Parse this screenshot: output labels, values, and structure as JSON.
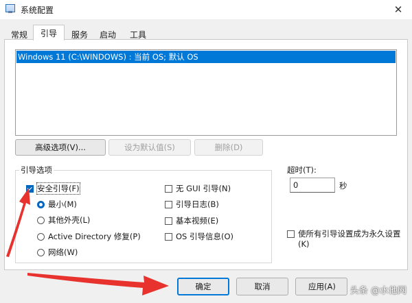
{
  "window": {
    "title": "系统配置",
    "close_glyph": "✕"
  },
  "tabs": [
    {
      "label": "常规"
    },
    {
      "label": "引导"
    },
    {
      "label": "服务"
    },
    {
      "label": "启动"
    },
    {
      "label": "工具"
    }
  ],
  "active_tab": "引导",
  "boot_list": {
    "items": [
      "Windows 11 (C:\\WINDOWS) : 当前 OS; 默认 OS"
    ]
  },
  "boot_buttons": {
    "advanced": "高级选项(V)...",
    "set_default": "设为默认值(S)",
    "delete": "删除(D)"
  },
  "boot_options": {
    "group_label": "引导选项",
    "safe_boot": {
      "label": "安全引导(F)",
      "checked": true
    },
    "minimal": {
      "label": "最小(M)",
      "selected": true
    },
    "alternate_shell": {
      "label": "其他外壳(L)",
      "selected": false
    },
    "active_directory": {
      "label": "Active Directory 修复(P)",
      "selected": false
    },
    "network": {
      "label": "网络(W)",
      "selected": false
    },
    "no_gui": {
      "label": "无 GUI 引导(N)",
      "checked": false
    },
    "boot_log": {
      "label": "引导日志(B)",
      "checked": false
    },
    "base_video": {
      "label": "基本视频(E)",
      "checked": false
    },
    "os_boot_info": {
      "label": "OS 引导信息(O)",
      "checked": false
    }
  },
  "timeout": {
    "label": "超时(T):",
    "value": "0",
    "unit": "秒"
  },
  "make_permanent": {
    "label_line1": "使所有引导设置成为永久设置",
    "label_line2": "(K)",
    "checked": false
  },
  "footer": {
    "ok": "确定",
    "cancel": "取消",
    "apply": "应用(A)"
  },
  "watermark": "头条 @水他网",
  "colors": {
    "selection": "#0078d7",
    "checkbox_accent": "#0067c0",
    "annotation_arrow": "#e8322e"
  },
  "icons": {
    "window_icon": "system-config-icon",
    "close": "close-icon"
  }
}
